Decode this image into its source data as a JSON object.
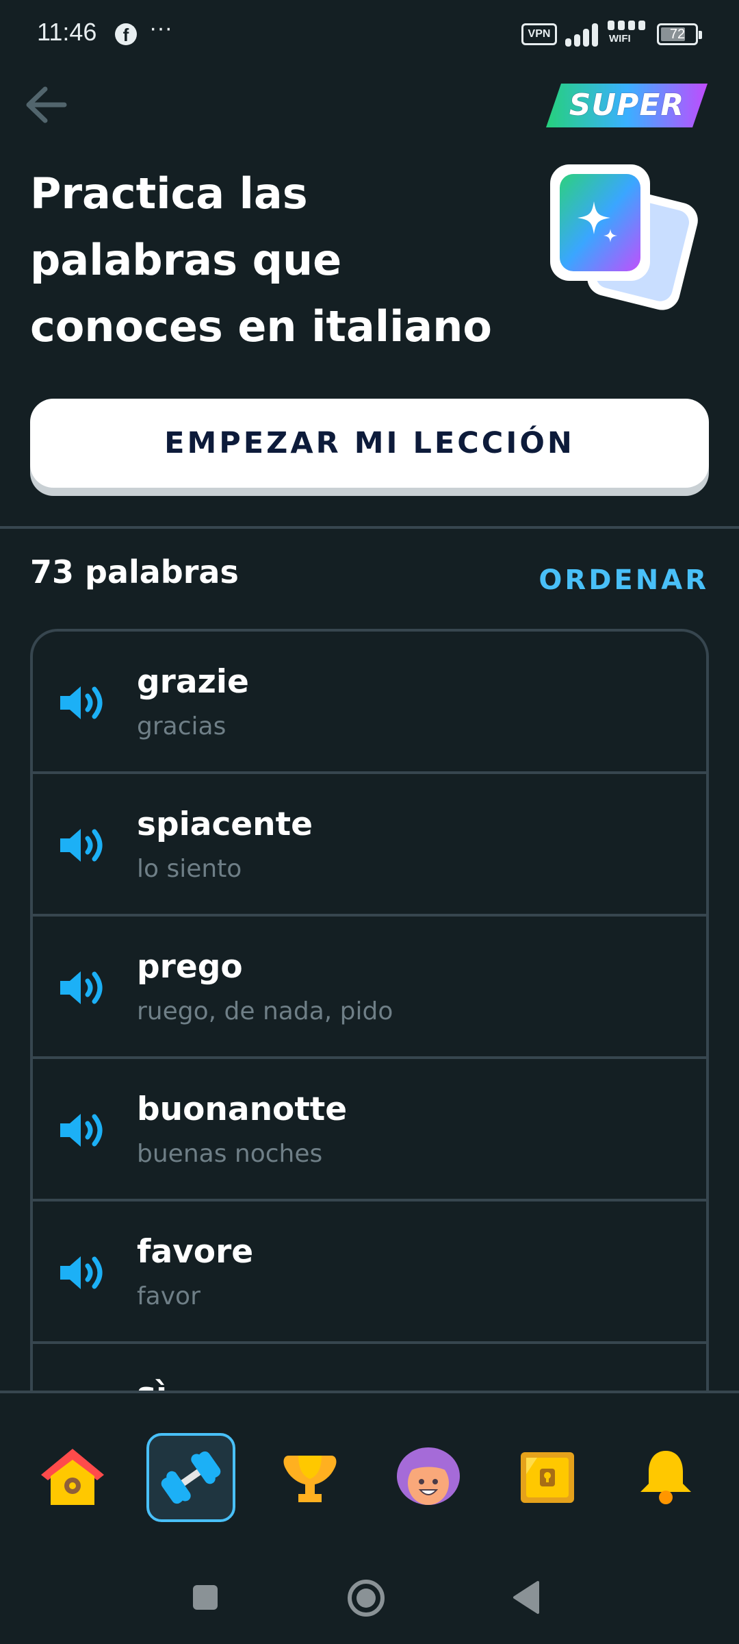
{
  "status_bar": {
    "time": "11:46",
    "facebook_glyph": "f",
    "more": "···",
    "vpn": "VPN",
    "wifi_label": "WIFI",
    "battery": "72",
    "battery_level": 0.72
  },
  "header": {
    "back_icon": "arrow-left-icon",
    "badge": "SUPER",
    "badge_gradient": [
      "#26d07c",
      "#3ab0ff",
      "#c04cfd"
    ]
  },
  "title": "Practica las palabras que conoces en italiano",
  "start_button": "EMPEZAR MI LECCIÓN",
  "words": {
    "count_label": "73 palabras",
    "sort_label": "ORDENAR",
    "items": [
      {
        "word": "grazie",
        "translation": "gracias"
      },
      {
        "word": "spiacente",
        "translation": "lo siento"
      },
      {
        "word": "prego",
        "translation": "ruego, de nada, pido"
      },
      {
        "word": "buonanotte",
        "translation": "buenas noches"
      },
      {
        "word": "favore",
        "translation": "favor"
      },
      {
        "word": "sì",
        "translation": ""
      }
    ]
  },
  "bottom_nav": {
    "items": [
      "home-icon",
      "practice-dumbbell-icon",
      "leaderboard-trophy-icon",
      "profile-avatar-icon",
      "treasure-chest-icon",
      "notifications-bell-icon"
    ],
    "active_index": 1
  },
  "colors": {
    "background": "#141f23",
    "divider": "#37464f",
    "accent": "#49c0f8",
    "muted_text": "#6f7f87"
  }
}
